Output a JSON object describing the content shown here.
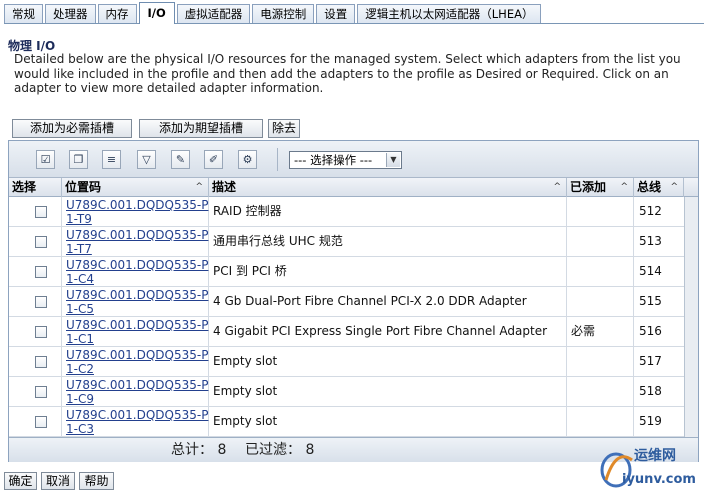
{
  "tabs": [
    "常规",
    "处理器",
    "内存",
    "I/O",
    "虚拟适配器",
    "电源控制",
    "设置",
    "逻辑主机以太网适配器（LHEA）"
  ],
  "active_tab": "I/O",
  "section_title": "物理 I/O",
  "description": "Detailed below are the physical I/O resources for the managed system. Select which adapters from the list you would like included in the profile and then add the adapters to the profile as Desired or Required. Click on an adapter to view more detailed adapter information.",
  "buttons": {
    "add_required": "添加为必需插槽",
    "add_desired": "添加为期望插槽",
    "remove": "除去"
  },
  "toolbar": {
    "icons": [
      "select-all-icon",
      "deselect-all-icon",
      "filter-icon",
      "show-filter-icon",
      "edit-sort-icon",
      "clear-sort-icon",
      "column-config-icon"
    ],
    "action_select": "--- 选择操作 ---"
  },
  "columns": {
    "select": "选择",
    "location": "位置码",
    "description": "描述",
    "added": "已添加",
    "bus": "总线"
  },
  "rows": [
    {
      "location": "U789C.001.DQDQ535-P1-T9",
      "description": "RAID 控制器",
      "added": "",
      "bus": "512"
    },
    {
      "location": "U789C.001.DQDQ535-P1-T7",
      "description": "通用串行总线 UHC 规范",
      "added": "",
      "bus": "513"
    },
    {
      "location": "U789C.001.DQDQ535-P1-C4",
      "description": "PCI 到 PCI 桥",
      "added": "",
      "bus": "514"
    },
    {
      "location": "U789C.001.DQDQ535-P1-C5",
      "description": "4 Gb Dual-Port Fibre Channel PCI-X 2.0 DDR Adapter",
      "added": "",
      "bus": "515"
    },
    {
      "location": "U789C.001.DQDQ535-P1-C1",
      "description": "4 Gigabit PCI Express Single Port Fibre Channel Adapter",
      "added": "必需",
      "bus": "516"
    },
    {
      "location": "U789C.001.DQDQ535-P1-C2",
      "description": "Empty slot",
      "added": "",
      "bus": "517"
    },
    {
      "location": "U789C.001.DQDQ535-P1-C9",
      "description": "Empty slot",
      "added": "",
      "bus": "518"
    },
    {
      "location": "U789C.001.DQDQ535-P1-C3",
      "description": "Empty slot",
      "added": "",
      "bus": "519"
    }
  ],
  "footer": {
    "total": "总计： 8",
    "filtered": "已过滤： 8"
  },
  "bottom_buttons": {
    "ok": "确定",
    "cancel": "取消",
    "help": "帮助"
  },
  "watermark": {
    "top": "运维网",
    "bottom": "iyunv.com"
  },
  "colors": {
    "link": "#23408e",
    "tab_border": "#7a96b5",
    "header_bg": "#dbe2eb"
  }
}
